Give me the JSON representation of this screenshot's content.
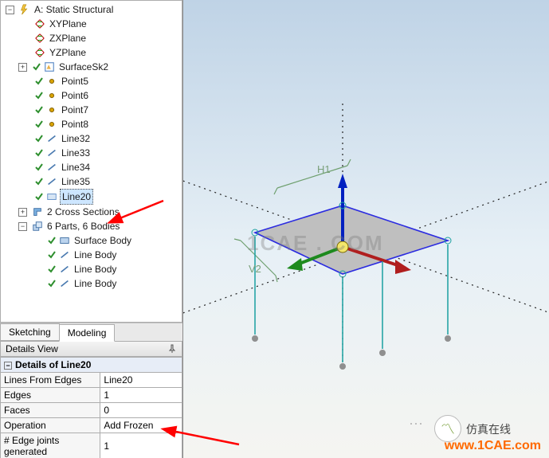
{
  "tree": {
    "root_label": "A: Static Structural",
    "planes": [
      "XYPlane",
      "ZXPlane",
      "YZPlane"
    ],
    "surface_group": "SurfaceSk2",
    "points": [
      "Point5",
      "Point6",
      "Point7",
      "Point8"
    ],
    "lines_a": [
      "Line32",
      "Line33",
      "Line34",
      "Line35"
    ],
    "sel_line": "Line20",
    "cross_sections": "2 Cross Sections",
    "parts_bodies": "6 Parts, 6 Bodies",
    "bodies": [
      "Surface Body",
      "Line Body",
      "Line Body",
      "Line Body"
    ]
  },
  "tabs": {
    "sketching": "Sketching",
    "modeling": "Modeling"
  },
  "details": {
    "panel_title": "Details View",
    "header": "Details of Line20",
    "rows": [
      {
        "key": "Lines From Edges",
        "val": "Line20"
      },
      {
        "key": "Edges",
        "val": "1"
      },
      {
        "key": "Faces",
        "val": "0"
      },
      {
        "key": "Operation",
        "val": "Add Frozen",
        "highlight": true
      },
      {
        "key": "# Edge joints generated",
        "val": "1"
      }
    ]
  },
  "viewport": {
    "dim_h1": "H1",
    "dim_v2": "V2",
    "watermark": "1CAE . COM"
  },
  "footer": {
    "brand": "仿真在线",
    "url": "www.1CAE.com"
  }
}
